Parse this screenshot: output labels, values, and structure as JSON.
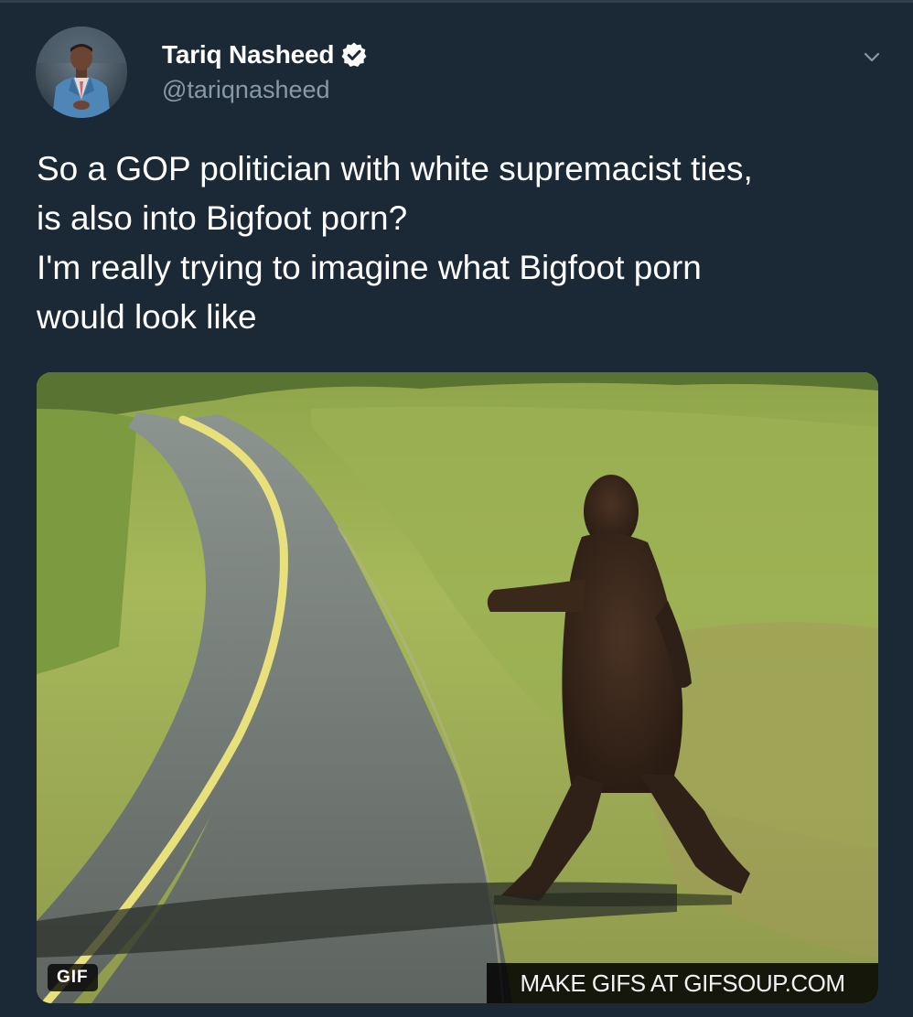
{
  "tweet": {
    "author": {
      "name": "Tariq Nasheed",
      "handle": "@tariqnasheed",
      "verified": true
    },
    "text": "So a GOP politician with white supremacist ties,\nis also into Bigfoot porn?\nI'm really trying to imagine what Bigfoot porn\nwould look like",
    "media": {
      "type_badge": "GIF",
      "watermark": "MAKE GIFS AT GIFSOUP.COM"
    }
  },
  "icons": {
    "verified": "verified-badge-icon",
    "menu": "chevron-down-icon"
  },
  "colors": {
    "background": "#1b2836",
    "text_primary": "#ffffff",
    "text_secondary": "#8899a6",
    "verified_badge": "#ffffff"
  }
}
